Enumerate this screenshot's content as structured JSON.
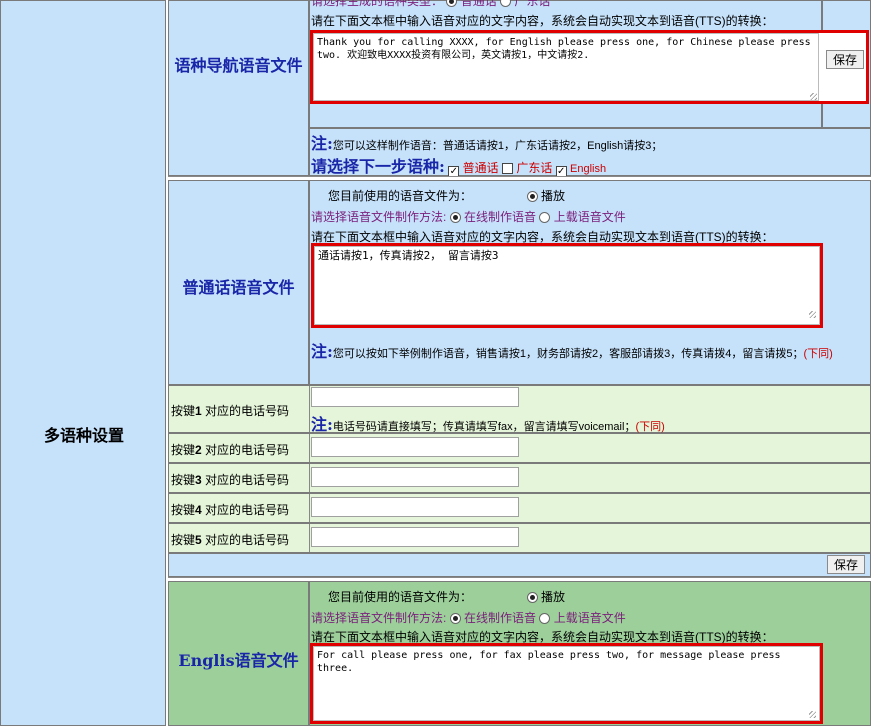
{
  "left_section": {
    "label": "多语种设置"
  },
  "nav_section": {
    "title": "语种导航语音文件",
    "partial_line": "请选择生成的语种类型：",
    "partial_opt1": "普通话",
    "partial_opt2": "广东话",
    "tts_instruction": "请在下面文本框中输入语音对应的文字内容，系统会自动实现文本到语音(TTS)的转换：",
    "textarea_value": "Thank you for calling XXXX, for English please press one, for Chinese please press two. 欢迎致电XXXX投资有限公司，英文请按1，中文请按2.",
    "save_label": "保存",
    "note_prefix": "注:",
    "note_text": "您可以这样制作语音：普通话请按1，广东话请按2，English请按3；",
    "next_prompt": "请选择下一步语种:",
    "next_options": [
      {
        "label": "普通话",
        "checked": true
      },
      {
        "label": "广东话",
        "checked": false
      },
      {
        "label": "English",
        "checked": true
      }
    ]
  },
  "mandarin_section": {
    "title": "普通话语音文件",
    "current_file_label": "您目前使用的语音文件为：",
    "play_label": "播放",
    "method_label": "请选择语音文件制作方法:",
    "method_online": "在线制作语音",
    "method_upload": "上载语音文件",
    "tts_instruction": "请在下面文本框中输入语音对应的文字内容，系统会自动实现文本到语音(TTS)的转换：",
    "textarea_value": "通话请按1，传真请按2， 留言请按3",
    "note_prefix": "注:",
    "note_text": "您可以按如下举例制作语音，销售请按1，财务部请按2，客服部请拨3，传真请拨4，留言请拨5；",
    "note_same": "(下同)",
    "phone_note_prefix": "注:",
    "phone_note_text": "电话号码请直接填写；传真请填写fax，留言请填写voicemail；",
    "phone_note_same": "(下同)",
    "key_rows": [
      {
        "prefix": "按键",
        "num": "1",
        "suffix": "对应的电话号码",
        "value": ""
      },
      {
        "prefix": "按键",
        "num": "2",
        "suffix": "对应的电话号码",
        "value": ""
      },
      {
        "prefix": "按键",
        "num": "3",
        "suffix": "对应的电话号码",
        "value": ""
      },
      {
        "prefix": "按键",
        "num": "4",
        "suffix": "对应的电话号码",
        "value": ""
      },
      {
        "prefix": "按键",
        "num": "5",
        "suffix": "对应的电话号码",
        "value": ""
      }
    ],
    "save_label": "保存"
  },
  "english_section": {
    "title": "Englis语音文件",
    "current_file_label": "您目前使用的语音文件为：",
    "play_label": "播放",
    "method_label": "请选择语音文件制作方法:",
    "method_online": "在线制作语音",
    "method_upload": "上载语音文件",
    "tts_instruction": "请在下面文本框中输入语音对应的文字内容，系统会自动实现文本到语音(TTS)的转换：",
    "textarea_value": "For call please press one, for fax please press two, for message please press three."
  },
  "colors": {
    "light_blue": "#c6e2fb",
    "light_green": "#e5f5d9",
    "dark_green": "#9dcf9b",
    "title_blue": "#1a26a8",
    "highlight_red": "#e00000",
    "purple_text": "#7a1f7a"
  }
}
